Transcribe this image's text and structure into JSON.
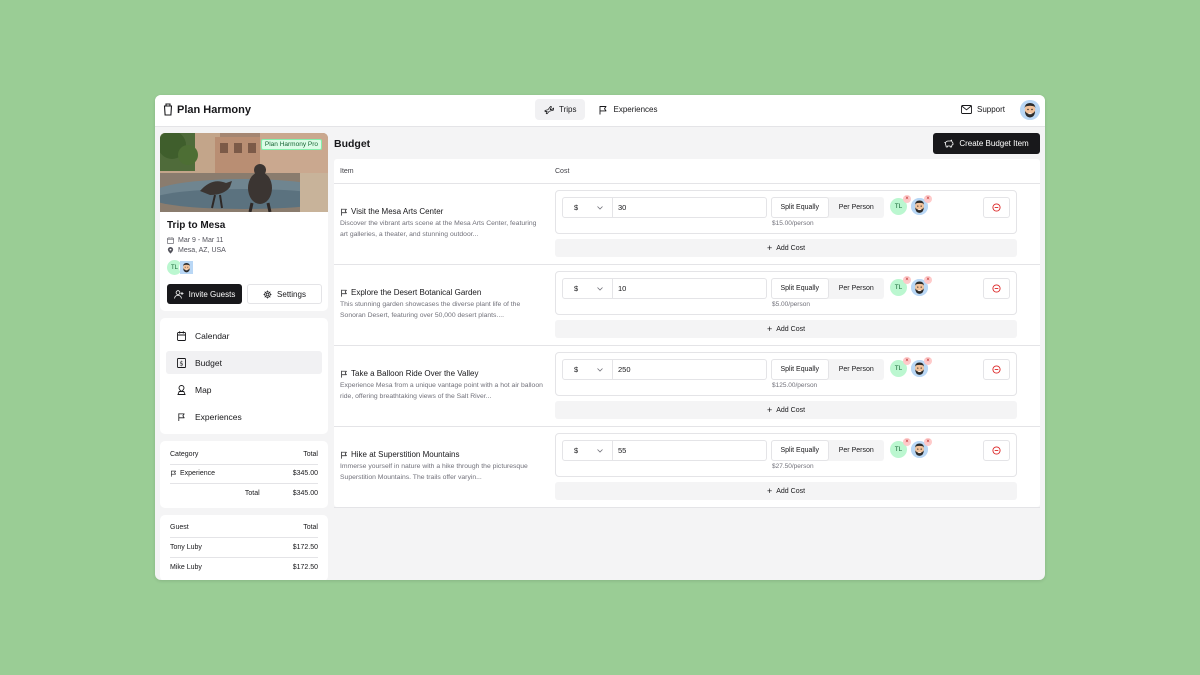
{
  "app": {
    "brand": "Plan Harmony",
    "nav": {
      "trips": "Trips",
      "experiences": "Experiences"
    },
    "support": "Support"
  },
  "trip": {
    "badge": "Plan Harmony Pro",
    "title": "Trip to Mesa",
    "dates": "Mar 9 - Mar 11",
    "location": "Mesa, AZ, USA",
    "guests": [
      "TL"
    ],
    "invite_label": "Invite Guests",
    "settings_label": "Settings"
  },
  "sidenav": {
    "calendar": "Calendar",
    "budget": "Budget",
    "map": "Map",
    "experiences": "Experiences"
  },
  "category_summary": {
    "header": {
      "category": "Category",
      "total": "Total"
    },
    "rows": [
      {
        "label": "Experience",
        "total": "$345.00"
      }
    ],
    "total_label": "Total",
    "total_value": "$345.00"
  },
  "guest_summary": {
    "header": {
      "guest": "Guest",
      "total": "Total"
    },
    "rows": [
      {
        "name": "Tony Luby",
        "total": "$172.50"
      },
      {
        "name": "Mike Luby",
        "total": "$172.50"
      }
    ]
  },
  "budget": {
    "title": "Budget",
    "create_label": "Create Budget Item",
    "columns": {
      "item": "Item",
      "cost": "Cost"
    },
    "split_equally": "Split Equally",
    "per_person": "Per Person",
    "add_cost": "Add Cost",
    "currency": "$",
    "assignee_initials": "TL",
    "remove_mark": "×",
    "items": [
      {
        "title": "Visit the Mesa Arts Center",
        "desc": "Discover the vibrant arts scene at the Mesa Arts Center, featuring art galleries, a theater, and stunning outdoor...",
        "amount": "30",
        "per_person_text": "$15.00/person"
      },
      {
        "title": "Explore the Desert Botanical Garden",
        "desc": "This stunning garden showcases the diverse plant life of the Sonoran Desert, featuring over 50,000 desert plants....",
        "amount": "10",
        "per_person_text": "$5.00/person"
      },
      {
        "title": "Take a Balloon Ride Over the Valley",
        "desc": "Experience Mesa from a unique vantage point with a hot air balloon ride, offering breathtaking views of the Salt River...",
        "amount": "250",
        "per_person_text": "$125.00/person"
      },
      {
        "title": "Hike at Superstition Mountains",
        "desc": "Immerse yourself in nature with a hike through the picturesque Superstition Mountains. The trails offer varyin...",
        "amount": "55",
        "per_person_text": "$27.50/person"
      }
    ]
  },
  "colors": {
    "background": "#9acd95",
    "primary": "#18181b",
    "badge_green": "#dcfce7",
    "remove_red": "#dc2626"
  }
}
